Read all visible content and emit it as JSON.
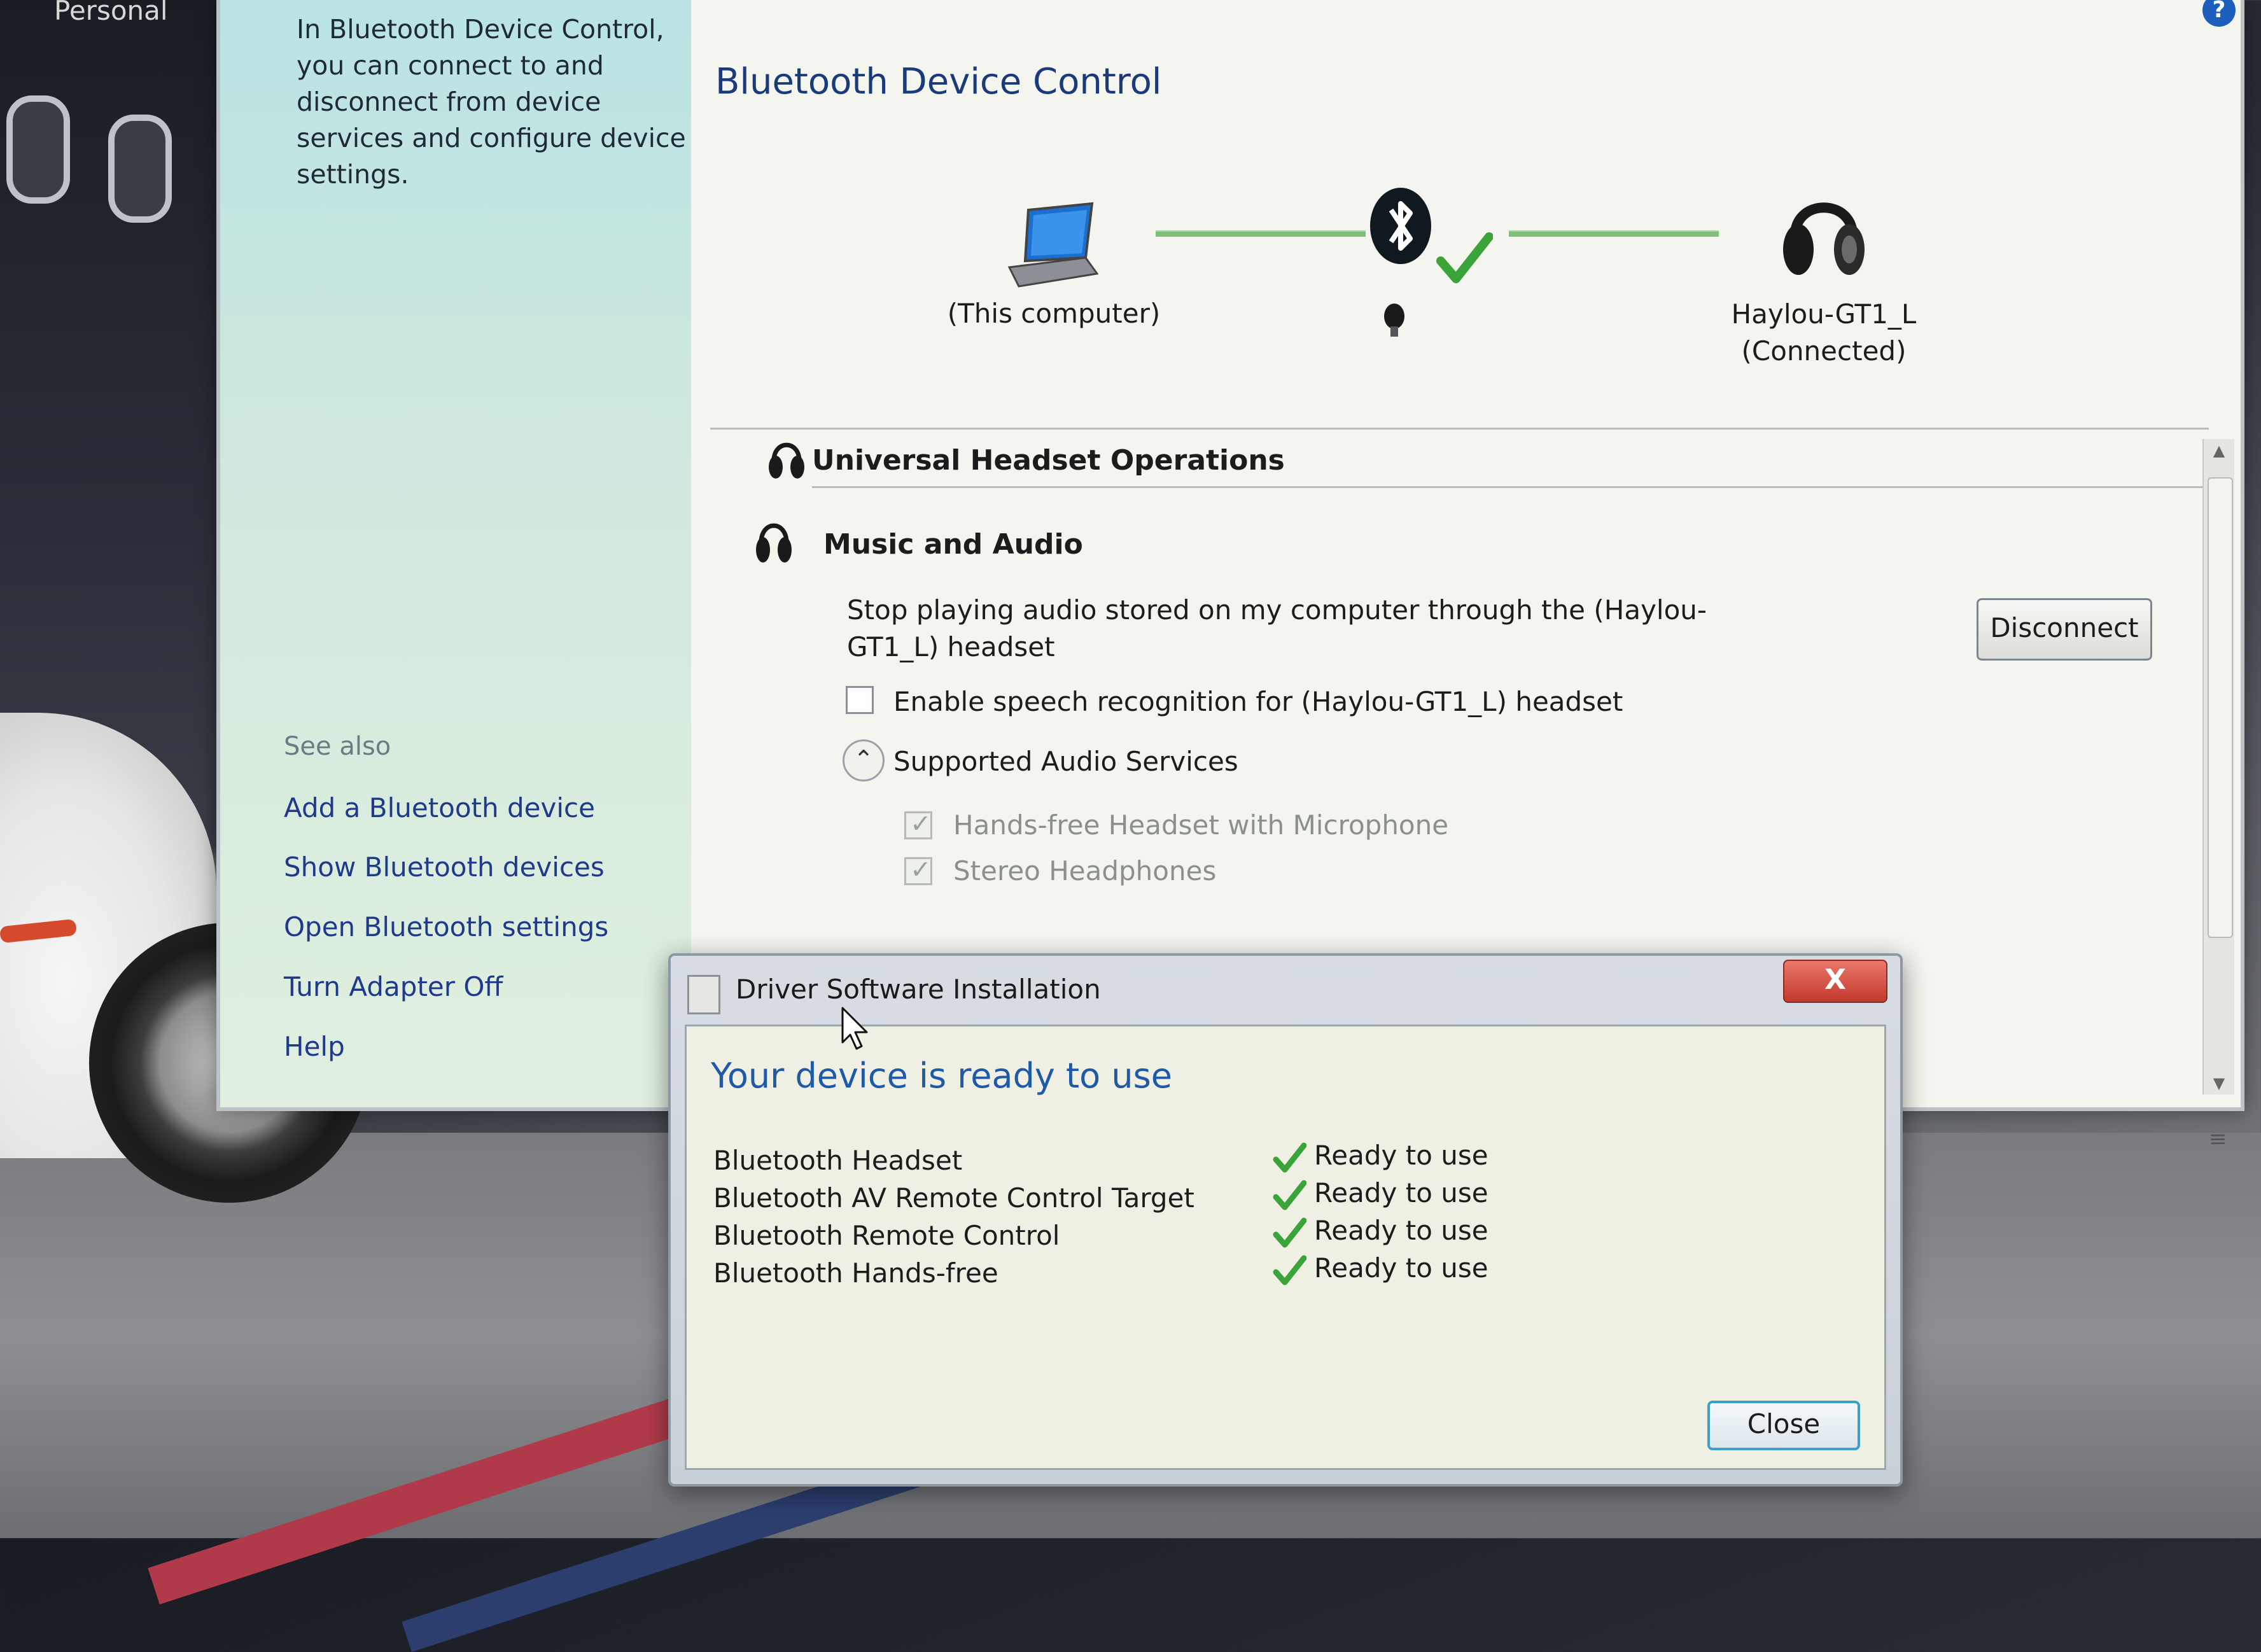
{
  "desktop": {
    "personal_label": "Personal"
  },
  "sidebar": {
    "intro": "In Bluetooth Device Control, you can connect to and disconnect from device services and configure device settings.",
    "see_also": "See also",
    "links": [
      "Add a Bluetooth device",
      "Show Bluetooth devices",
      "Open Bluetooth settings",
      "Turn Adapter Off",
      "Help"
    ]
  },
  "main": {
    "title": "Bluetooth Device Control",
    "computer_label": "(This computer)",
    "headset_name": "Haylou-GT1_L",
    "headset_status": "(Connected)",
    "section_title": "Universal Headset Operations",
    "music_title": "Music and Audio",
    "stop_text": "Stop playing audio stored on my computer through the (Haylou-GT1_L) headset",
    "disconnect_label": "Disconnect",
    "speech_label": "Enable speech recognition for (Haylou-GT1_L) headset",
    "speech_checked": false,
    "services_label": "Supported Audio Services",
    "services": [
      "Hands-free Headset with Microphone",
      "Stereo Headphones"
    ]
  },
  "dialog": {
    "title": "Driver Software Installation",
    "close_x": "X",
    "heading": "Your device is ready to use",
    "devices": [
      {
        "name": "Bluetooth Headset",
        "status": "Ready to use"
      },
      {
        "name": "Bluetooth AV Remote Control Target",
        "status": "Ready to use"
      },
      {
        "name": "Bluetooth Remote Control",
        "status": "Ready to use"
      },
      {
        "name": "Bluetooth Hands-free",
        "status": "Ready to use"
      }
    ],
    "close_label": "Close"
  },
  "icons": {
    "laptop": "laptop-icon",
    "bluetooth": "bluetooth-icon",
    "check": "check-icon",
    "headset": "headset-icon",
    "help": "help-icon"
  },
  "colors": {
    "accent_blue": "#1a3a7a",
    "heading_blue": "#1e5aa8",
    "check_green": "#3aa43a",
    "close_red": "#c23a2c"
  }
}
